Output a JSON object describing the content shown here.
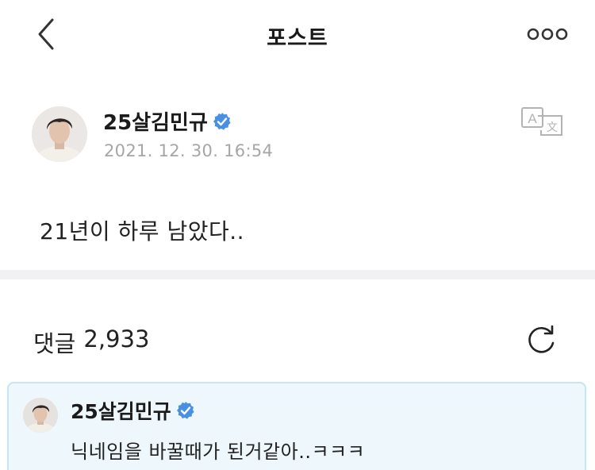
{
  "nav": {
    "title": "포스트",
    "back_icon": "chevron-left-icon",
    "more_icon": "more-dots-icon"
  },
  "post": {
    "author": "25살김민규",
    "verified_icon": "verified-badge-icon",
    "timestamp": "2021. 12. 30. 16:54",
    "translate_icon": "translate-icon",
    "body": "21년이 하루 남았다.."
  },
  "comments": {
    "label": "댓글",
    "count": "2,933",
    "refresh_icon": "refresh-icon",
    "highlighted": {
      "author": "25살김민규",
      "text": "닉네임을 바꿀때가 된거같아..ㅋㅋㅋ"
    }
  },
  "colors": {
    "verified_blue": "#4a90e2",
    "highlight_bg": "#eef7fc",
    "highlight_border": "#c5e6f4",
    "timestamp_gray": "#a6a6a6",
    "divider": "#f1f1f3"
  }
}
